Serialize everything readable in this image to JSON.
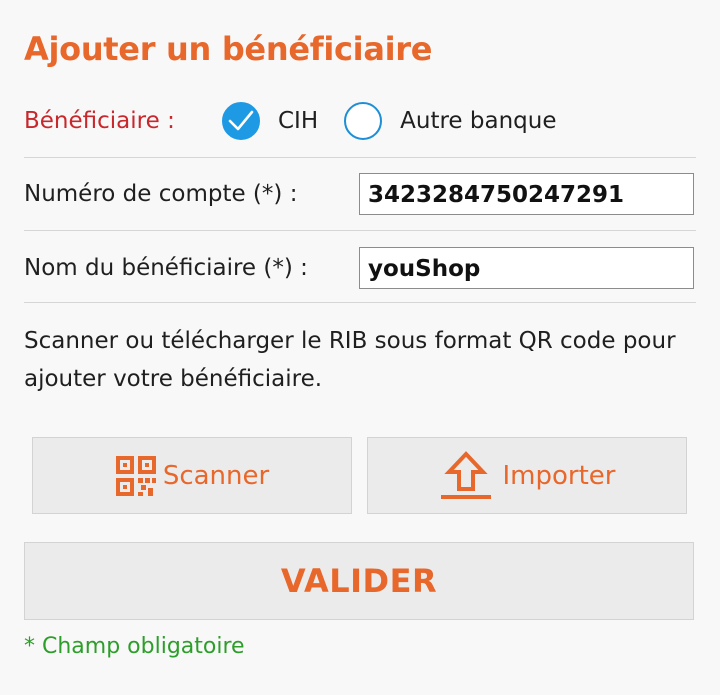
{
  "page": {
    "title": "Ajouter un bénéficiaire"
  },
  "beneficiary_type": {
    "label": "Bénéficiaire :",
    "options": [
      {
        "label": "CIH",
        "selected": true
      },
      {
        "label": "Autre banque",
        "selected": false
      }
    ]
  },
  "form": {
    "account_number": {
      "label": "Numéro de compte (*) :",
      "value": "3423284750247291"
    },
    "beneficiary_name": {
      "label": "Nom du bénéficiaire (*) :",
      "value": "youShop"
    }
  },
  "description": "Scanner ou télécharger le RIB sous format QR code pour ajouter votre bénéficiaire.",
  "actions": {
    "scan_label": "Scanner",
    "scan_icon": "qr-code-icon",
    "import_label": "Importer",
    "import_icon": "upload-arrow-icon",
    "validate_label": "VALIDER"
  },
  "note": "* Champ obligatoire",
  "colors": {
    "accent": "#e8672b",
    "label_red": "#c8272c",
    "radio_blue": "#1e9ae5",
    "note_green": "#2e9e2b"
  }
}
